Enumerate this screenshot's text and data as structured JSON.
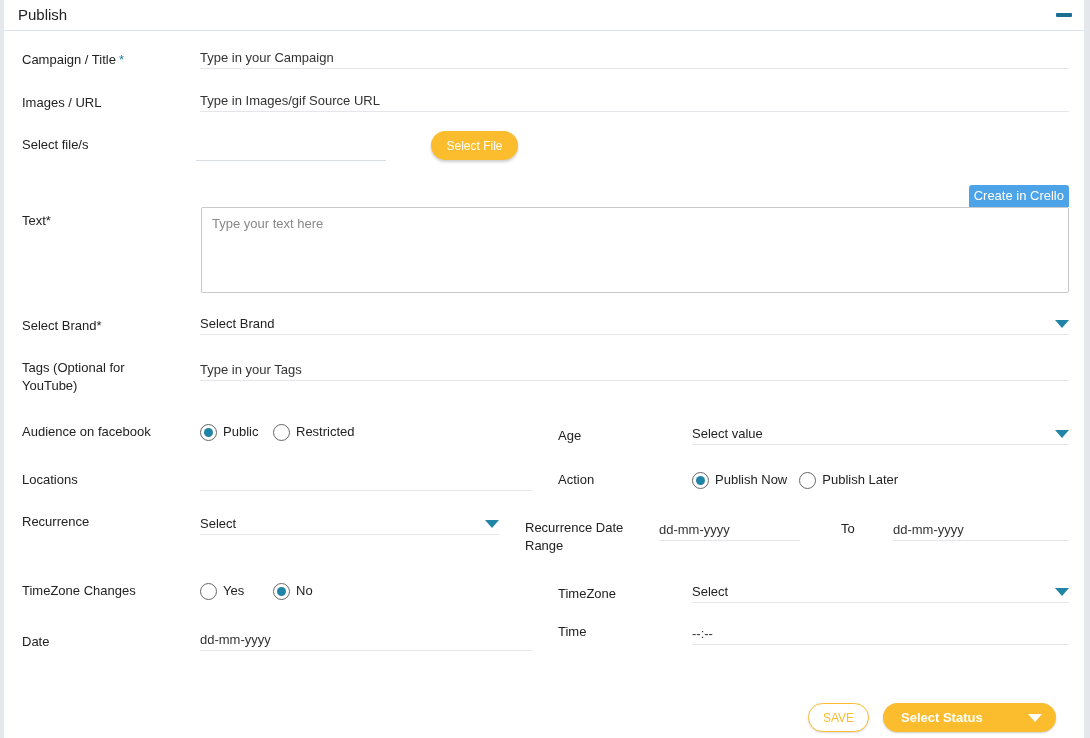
{
  "panel": {
    "title": "Publish"
  },
  "campaign": {
    "label": "Campaign / Title",
    "mark": "*",
    "placeholder": "Type in your Campaign"
  },
  "images": {
    "label": "Images / URL",
    "placeholder": "Type in Images/gif Source URL"
  },
  "file": {
    "label": "Select file/s",
    "button": "Select File"
  },
  "crello_button": "Create in Crello",
  "text": {
    "label": "Text*",
    "placeholder": "Type your text here"
  },
  "brand": {
    "label": "Select Brand*",
    "value": "Select Brand"
  },
  "tags": {
    "label": "Tags (Optional for YouTube)",
    "placeholder": "Type in your Tags"
  },
  "audience": {
    "label": "Audience on facebook",
    "options": [
      {
        "label": "Public",
        "selected": true
      },
      {
        "label": "Restricted",
        "selected": false
      }
    ]
  },
  "age": {
    "label": "Age",
    "value": "Select value"
  },
  "locations": {
    "label": "Locations"
  },
  "action": {
    "label": "Action",
    "options": [
      {
        "label": "Publish Now",
        "selected": true
      },
      {
        "label": "Publish Later",
        "selected": false
      }
    ]
  },
  "recurrence": {
    "label": "Recurrence",
    "value": "Select"
  },
  "recurrence_range": {
    "label": "Recurrence Date Range",
    "from_placeholder": "dd-mm-yyyy",
    "to_label": "To",
    "to_placeholder": "dd-mm-yyyy"
  },
  "timezone_changes": {
    "label": "TimeZone Changes",
    "options": [
      {
        "label": "Yes",
        "selected": false
      },
      {
        "label": "No",
        "selected": true
      }
    ]
  },
  "timezone": {
    "label": "TimeZone",
    "value": "Select"
  },
  "date": {
    "label": "Date",
    "placeholder": "dd-mm-yyyy"
  },
  "time": {
    "label": "Time",
    "placeholder": "--:--"
  },
  "footer": {
    "save": "SAVE",
    "status": "Select Status"
  }
}
